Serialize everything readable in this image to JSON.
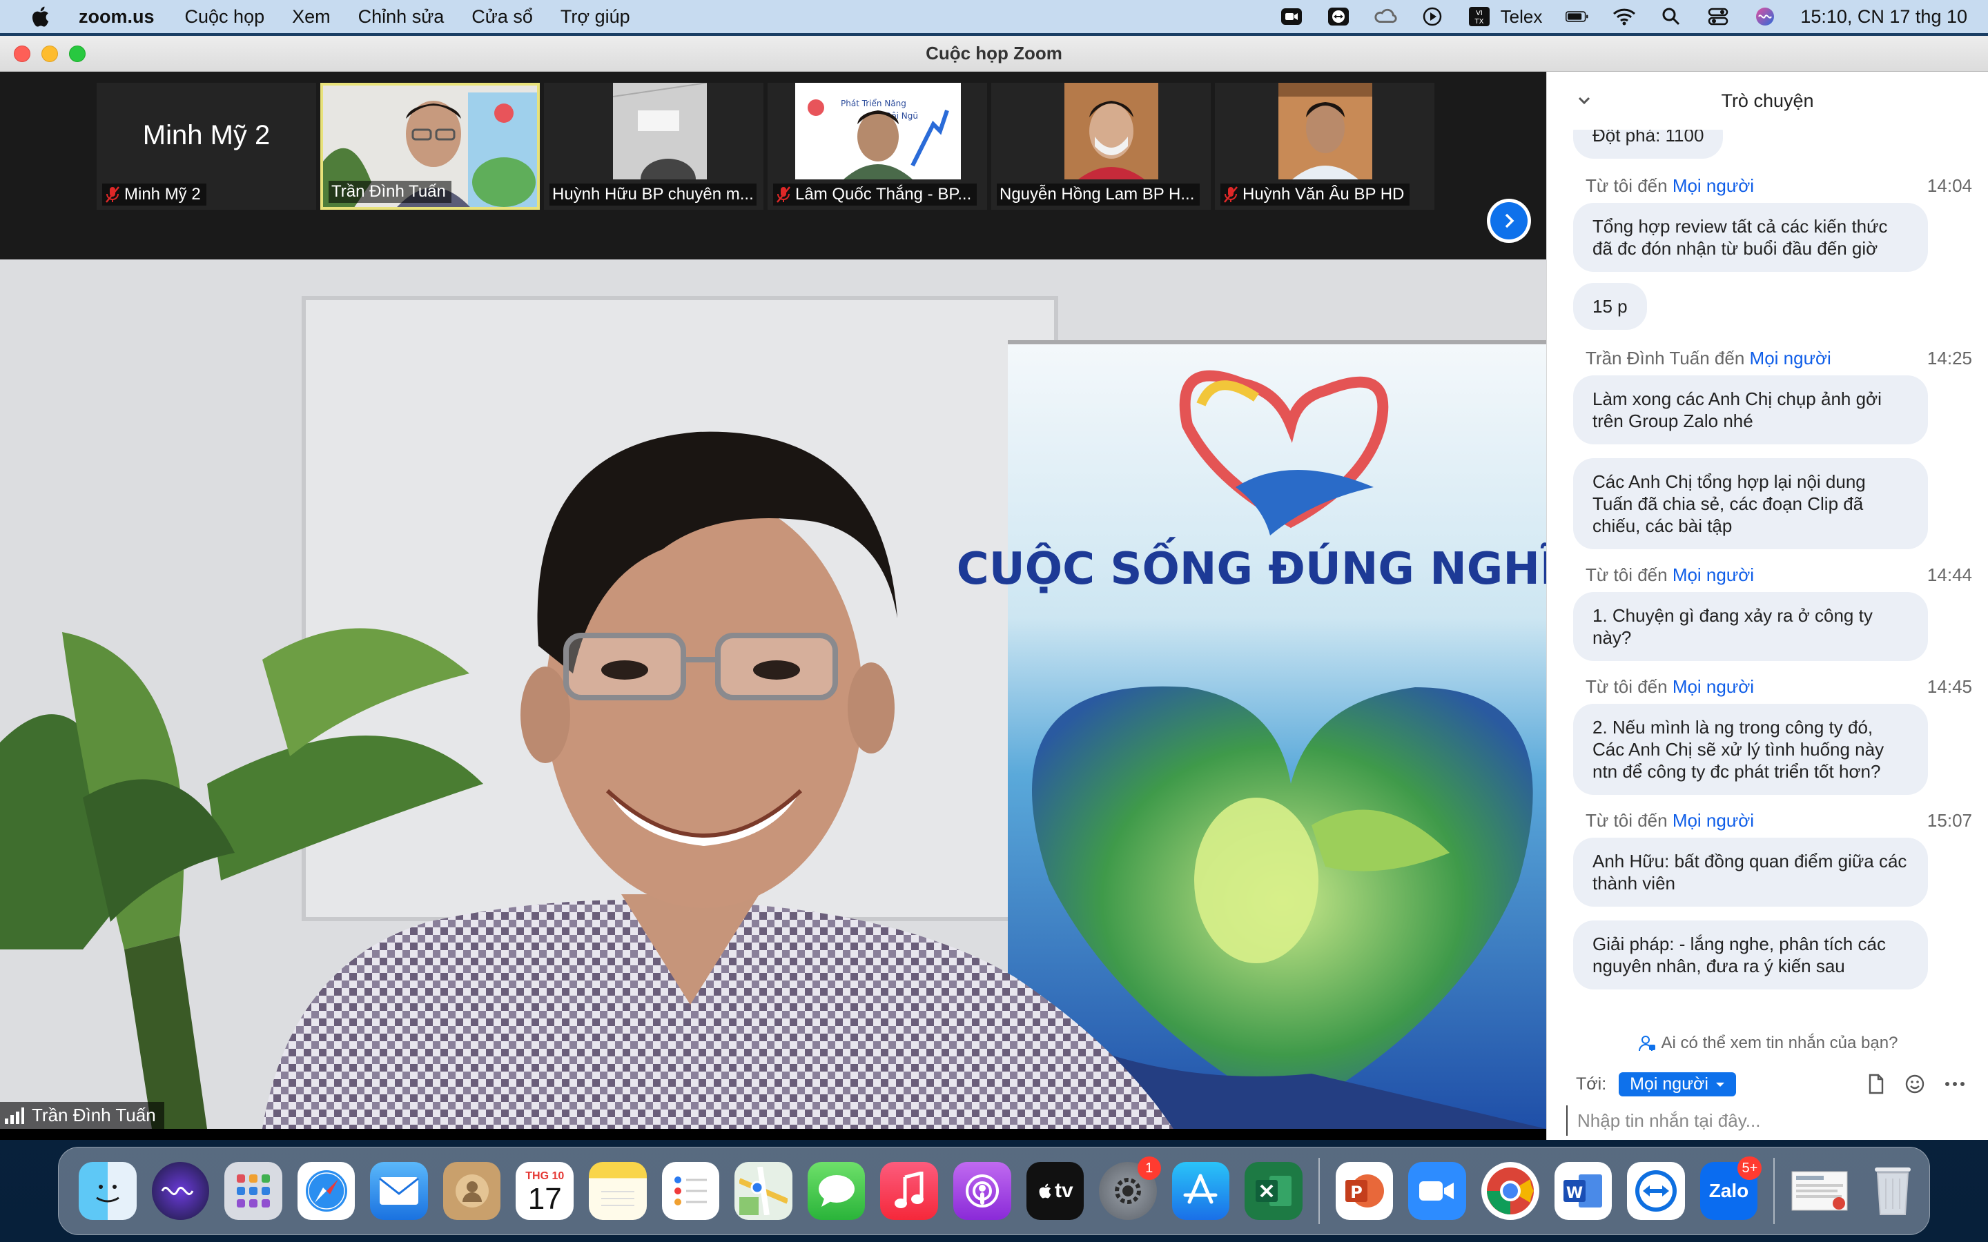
{
  "menubar": {
    "app_name": "zoom.us",
    "menus": [
      "Cuộc họp",
      "Xem",
      "Chỉnh sửa",
      "Cửa sổ",
      "Trợ giúp"
    ],
    "input_method": "Telex",
    "clock": "15:10, CN 17 thg 10"
  },
  "window": {
    "title": "Cuộc họp Zoom"
  },
  "participants": [
    {
      "name": "Minh Mỹ 2",
      "big_name": "Minh Mỹ 2",
      "muted": true
    },
    {
      "name": "Trần Đình Tuấn",
      "muted": false,
      "active": true
    },
    {
      "name": "Huỳnh Hữu BP chuyên m...",
      "muted": false
    },
    {
      "name": "Lâm Quốc Thắng - BP...",
      "muted": true
    },
    {
      "name": "Nguyễn Hồng Lam BP H...",
      "muted": false
    },
    {
      "name": "Huỳnh Văn Âu BP HD",
      "muted": true
    }
  ],
  "main_video": {
    "speaker": "Trần Đình Tuấn",
    "banner_text": "CUỘC SỐNG ĐÚNG NGHĨA",
    "logo_text": "Cuộc Sống Đúng Nghĩa"
  },
  "chat": {
    "title": "Trò chuyện",
    "truncated_top": "Đột phá: 1100",
    "groups": [
      {
        "from": "Từ tôi đến",
        "to": "Mọi người",
        "time": "14:04",
        "messages": [
          "Tổng hợp review tất cả các kiến thức đã đc đón nhận từ buổi đầu đến giờ",
          "15 p"
        ]
      },
      {
        "from": "Trần Đình Tuấn đến",
        "to": "Mọi người",
        "time": "14:25",
        "messages": [
          "Làm xong các Anh Chị chụp ảnh gởi trên Group Zalo nhé",
          "Các Anh Chị tổng hợp lại nội dung Tuấn đã chia sẻ, các đoạn Clip đã chiếu, các bài tập"
        ]
      },
      {
        "from": "Từ tôi đến",
        "to": "Mọi người",
        "time": "14:44",
        "messages": [
          "1. Chuyện gì đang xảy ra ở công ty này?"
        ]
      },
      {
        "from": "Từ tôi đến",
        "to": "Mọi người",
        "time": "14:45",
        "messages": [
          "2. Nếu mình là ng trong công ty đó, Các Anh Chị sẽ xử lý tình huống này ntn để công ty đc phát triển tốt hơn?"
        ]
      },
      {
        "from": "Từ tôi đến",
        "to": "Mọi người",
        "time": "15:07",
        "messages": [
          "Anh Hữu: bất đồng quan điểm giữa các thành viên",
          "Giải pháp: - lắng nghe, phân tích các nguyên nhân, đưa ra ý kiến sau"
        ]
      }
    ],
    "privacy_text": "Ai có thể xem tin nhắn của bạn?",
    "to_label": "Tới:",
    "to_value": "Mọi người",
    "input_placeholder": "Nhập tin nhắn tại đây..."
  },
  "dock": {
    "calendar_month": "THG 10",
    "calendar_day": "17",
    "settings_badge": "1",
    "zalo_label": "Zalo",
    "zalo_badge": "5+",
    "tv_label": "tv"
  },
  "colors": {
    "zoom_blue": "#0e71eb",
    "chat_bubble": "#ebeff6",
    "active_tile_border": "#e8e27a",
    "muted_mic": "#e02828"
  }
}
